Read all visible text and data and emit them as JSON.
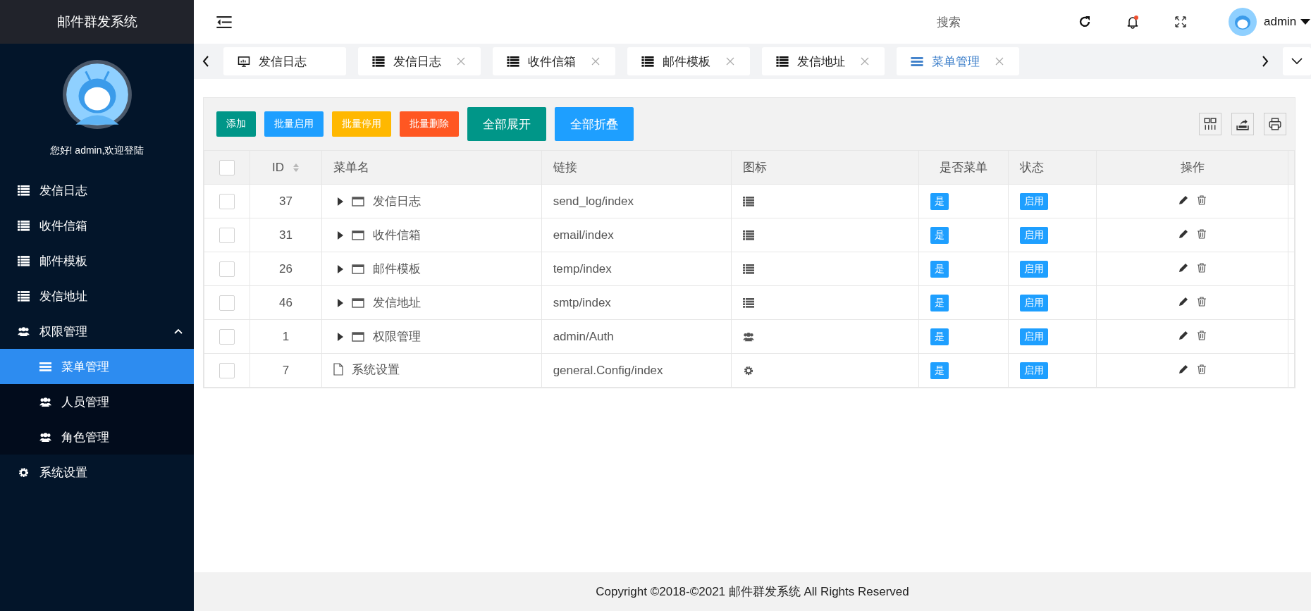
{
  "sidebar": {
    "title": "邮件群发系统",
    "greeting": "您好! admin,欢迎登陆",
    "items": [
      {
        "label": "发信日志",
        "kind": "list",
        "selected": false
      },
      {
        "label": "收件信箱",
        "kind": "list",
        "selected": false
      },
      {
        "label": "邮件模板",
        "kind": "list",
        "selected": false
      },
      {
        "label": "发信地址",
        "kind": "list",
        "selected": false
      },
      {
        "label": "权限管理",
        "kind": "users",
        "selected": false,
        "expanded": true,
        "children": [
          {
            "label": "菜单管理",
            "kind": "bars",
            "selected": true
          },
          {
            "label": "人员管理",
            "kind": "users",
            "selected": false
          },
          {
            "label": "角色管理",
            "kind": "users",
            "selected": false
          }
        ]
      },
      {
        "label": "系统设置",
        "kind": "gear",
        "selected": false
      }
    ]
  },
  "header": {
    "search": "搜索",
    "user": "admin"
  },
  "tabs": [
    {
      "label": "发信日志",
      "kind": "home",
      "selected": false
    },
    {
      "label": "发信日志",
      "kind": "page",
      "selected": false
    },
    {
      "label": "收件信箱",
      "kind": "page",
      "selected": false
    },
    {
      "label": "邮件模板",
      "kind": "page",
      "selected": false
    },
    {
      "label": "发信地址",
      "kind": "page",
      "selected": false
    },
    {
      "label": "菜单管理",
      "kind": "current",
      "selected": true
    }
  ],
  "toolbar": {
    "buttons": [
      {
        "label": "添加",
        "kind": "teal-small"
      },
      {
        "label": "批量启用",
        "kind": "blue-small"
      },
      {
        "label": "批量停用",
        "kind": "yellow-small"
      },
      {
        "label": "批量删除",
        "kind": "red-small"
      },
      {
        "label": "全部展开",
        "kind": "teal"
      },
      {
        "label": "全部折叠",
        "kind": "blue"
      }
    ]
  },
  "table": {
    "header_checked": false,
    "columns": [
      "ID",
      "菜单名",
      "链接",
      "图标",
      "是否菜单",
      "状态",
      "操作"
    ],
    "rows": [
      {
        "checked": false,
        "id": "37",
        "name": "发信日志",
        "expandable": true,
        "link": "send_log/index",
        "kind": "list",
        "is_menu": "是",
        "status": "启用"
      },
      {
        "checked": false,
        "id": "31",
        "name": "收件信箱",
        "expandable": true,
        "link": "email/index",
        "kind": "list",
        "is_menu": "是",
        "status": "启用"
      },
      {
        "checked": false,
        "id": "26",
        "name": "邮件模板",
        "expandable": true,
        "link": "temp/index",
        "kind": "list",
        "is_menu": "是",
        "status": "启用"
      },
      {
        "checked": false,
        "id": "46",
        "name": "发信地址",
        "expandable": true,
        "link": "smtp/index",
        "kind": "list",
        "is_menu": "是",
        "status": "启用"
      },
      {
        "checked": false,
        "id": "1",
        "name": "权限管理",
        "expandable": true,
        "link": "admin/Auth",
        "kind": "users",
        "is_menu": "是",
        "status": "启用"
      },
      {
        "checked": false,
        "id": "7",
        "name": "系统设置",
        "expandable": false,
        "link": "general.Config/index",
        "kind": "gear",
        "is_menu": "是",
        "status": "启用"
      }
    ]
  },
  "footer": "Copyright ©2018-©2021 邮件群发系统 All Rights Reserved"
}
